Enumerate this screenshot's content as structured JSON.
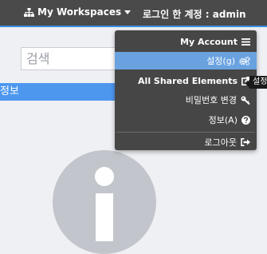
{
  "header": {
    "workspaces_label": "My Workspaces",
    "account_label": "로그인 한 계정 : admin"
  },
  "search": {
    "placeholder": "검색"
  },
  "selected_item": {
    "label": "정보"
  },
  "menu": {
    "items": [
      {
        "label": "My Account",
        "icon": "list-icon"
      },
      {
        "label": "설정(g)",
        "icon": "gears-icon"
      },
      {
        "label": "All Shared Elements",
        "icon": "external-link-icon"
      },
      {
        "label": "비밀번호 변경",
        "icon": "key-icon"
      },
      {
        "label": "정보(A)",
        "icon": "question-circle-icon"
      },
      {
        "label": "로그아웃",
        "icon": "sign-out-icon"
      }
    ]
  },
  "tooltip": {
    "text": "설정"
  },
  "colors": {
    "topbar": "#4a4a4a",
    "accent": "#4d97ef",
    "menu_bg": "#464646",
    "menu_active": "#6aa2e0"
  }
}
